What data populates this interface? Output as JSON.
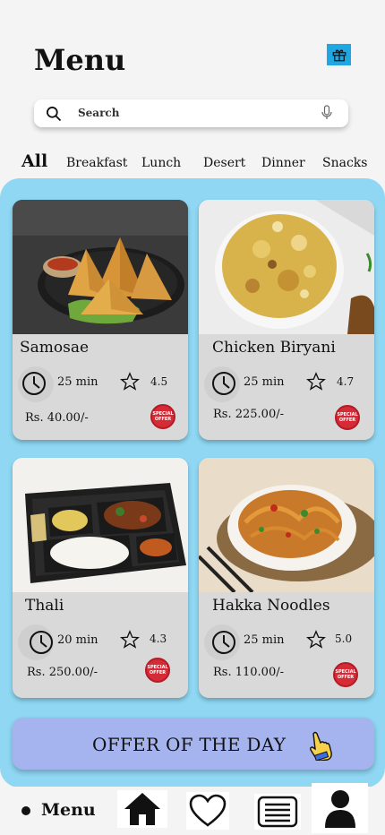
{
  "header": {
    "title": "Menu",
    "gift_icon": "gift-icon"
  },
  "search": {
    "placeholder": "Search",
    "search_icon": "search-icon",
    "mic_icon": "mic-icon"
  },
  "categories": [
    "All",
    "Breakfast",
    "Lunch",
    "Desert",
    "Dinner",
    "Snacks"
  ],
  "active_category": "All",
  "items": [
    {
      "name": "Samosae",
      "time": "25 min",
      "rating": "4.5",
      "price": "Rs. 40.00/-",
      "badge": "SPECIAL OFFER"
    },
    {
      "name": "Chicken Biryani",
      "time": "25 min",
      "rating": "4.7",
      "price": "Rs. 225.00/-",
      "badge": "SPECIAL OFFER"
    },
    {
      "name": "Thali",
      "time": "20 min",
      "rating": "4.3",
      "price": "Rs. 250.00/-",
      "badge": "SPECIAL OFFER"
    },
    {
      "name": "Hakka Noodles",
      "time": "25 min",
      "rating": "5.0",
      "price": "Rs. 110.00/-",
      "badge": "SPECIAL OFFER"
    }
  ],
  "offer": {
    "label": "OFFER OF THE DAY",
    "icon": "pointing-hand-icon"
  },
  "bottom_nav": {
    "menu_label": "Menu",
    "icons": [
      "home-icon",
      "heart-icon",
      "list-icon",
      "profile-icon"
    ]
  },
  "colors": {
    "background": "#f4f4f5",
    "panel": "#8fd7f3",
    "card": "#d9d9d9",
    "offer_button": "#a5b4ef",
    "gift": "#1ea7e3",
    "badge": "#d62b36"
  }
}
